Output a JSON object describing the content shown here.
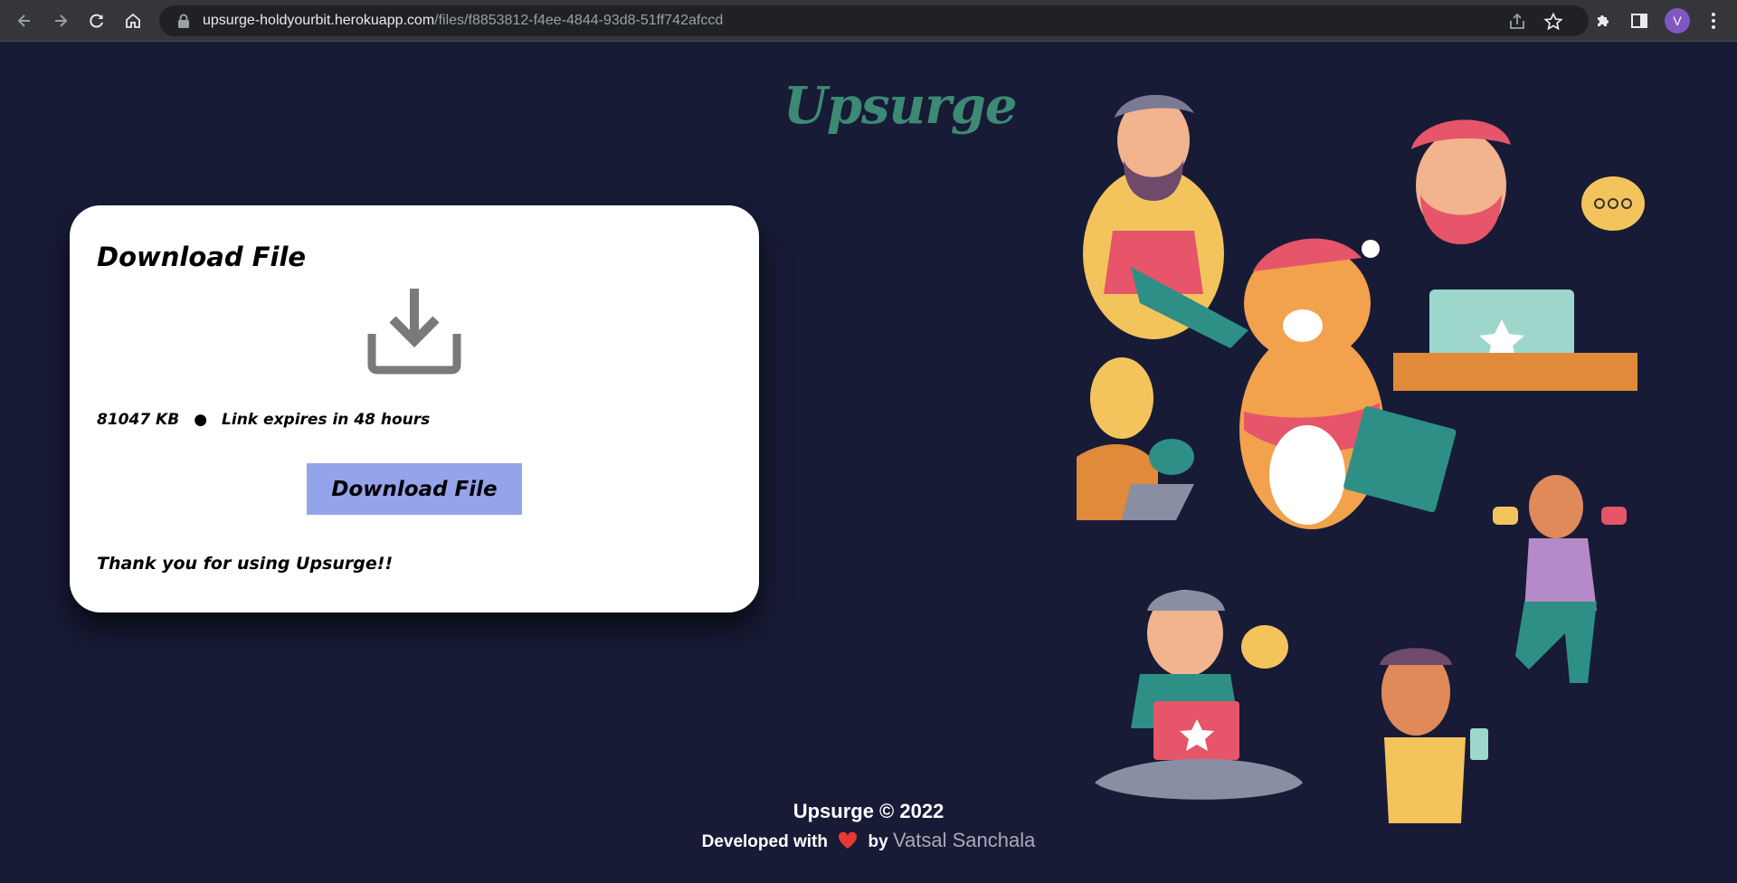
{
  "browser": {
    "url_host": "upsurge-holdyourbit.herokuapp.com",
    "url_path": "/files/f8853812-f4ee-4844-93d8-51ff742afccd",
    "profile_initial": "V"
  },
  "page": {
    "logo": "Upsurge",
    "card": {
      "title": "Download File",
      "file_size": "81047 KB",
      "separator": "●",
      "expiry": "Link expires in 48 hours",
      "button_label": "Download File",
      "thanks": "Thank you for using Upsurge!!"
    },
    "footer": {
      "copyright": "Upsurge © 2022",
      "developed_with": "Developed with",
      "by": "by",
      "author": "Vatsal Sanchala"
    }
  },
  "colors": {
    "background": "#171b36",
    "card": "#ffffff",
    "button": "#95a3eb",
    "logo": "#3d8a74",
    "heart": "#e53935"
  },
  "icons": [
    "back-icon",
    "forward-icon",
    "reload-icon",
    "home-icon",
    "lock-icon",
    "share-icon",
    "star-icon",
    "extensions-icon",
    "side-panel-icon",
    "menu-icon",
    "download-icon",
    "heart-icon"
  ]
}
